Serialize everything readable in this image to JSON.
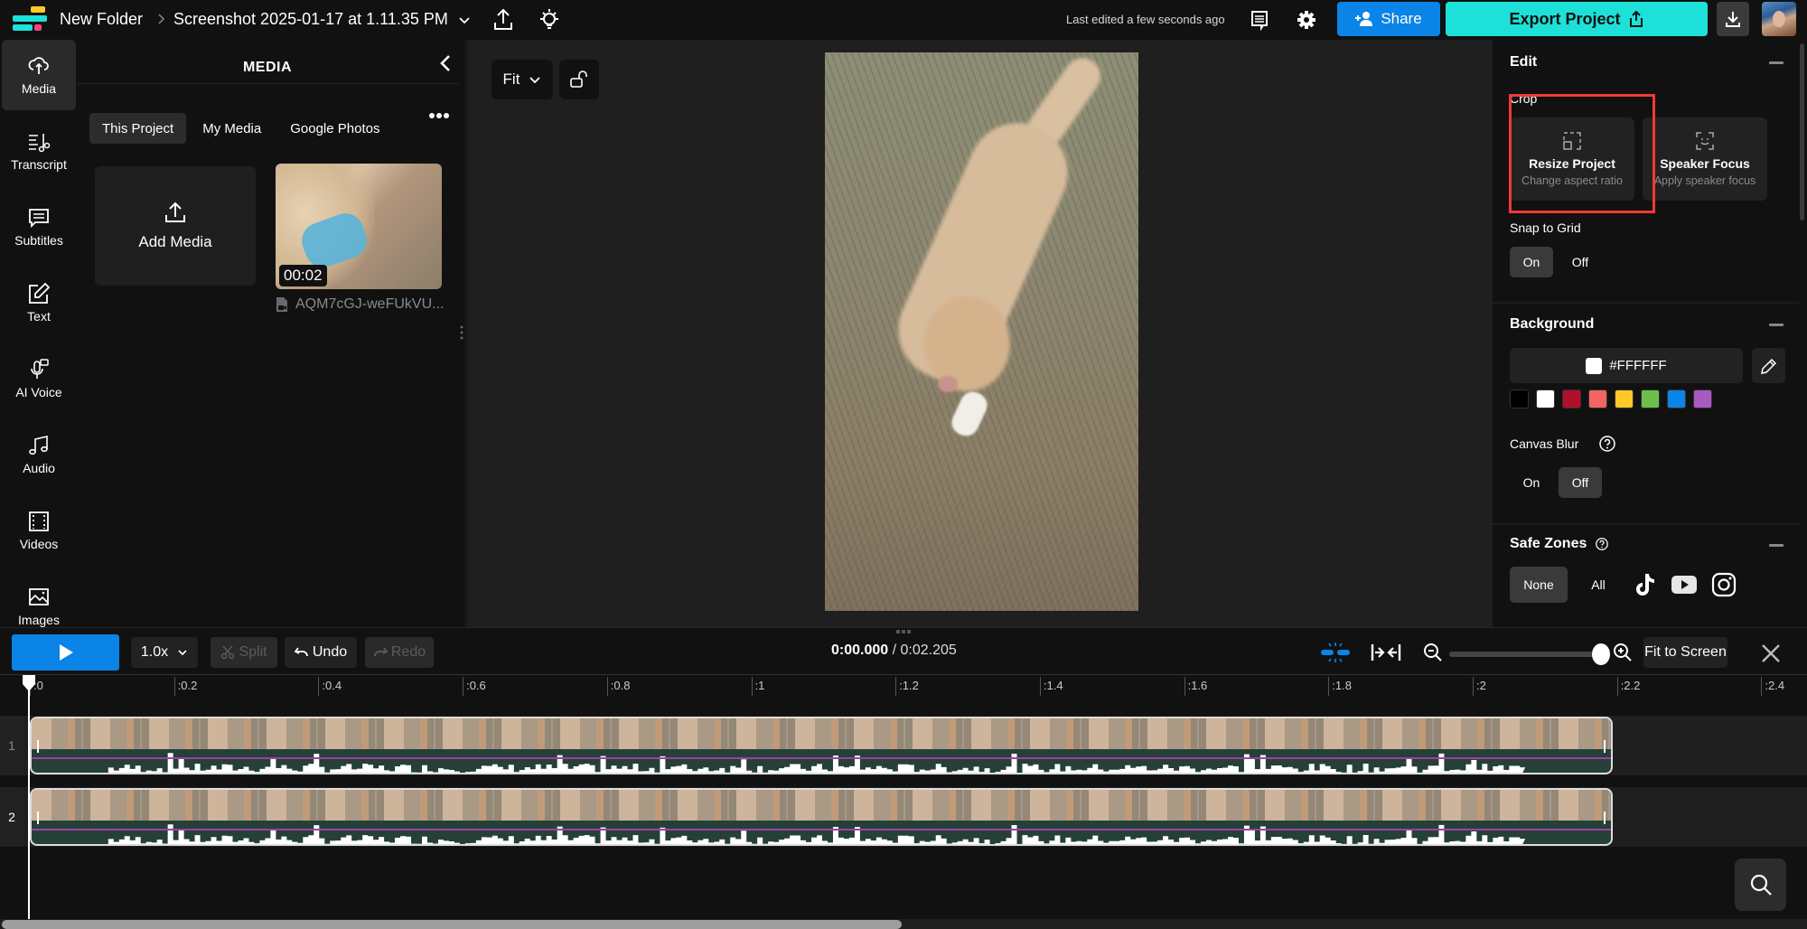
{
  "header": {
    "folder": "New Folder",
    "project_title": "Screenshot 2025-01-17 at 1.11.35 PM",
    "last_edited": "Last edited a few seconds ago",
    "share_label": "Share",
    "export_label": "Export Project"
  },
  "colors": {
    "accent_blue": "#0A84E6",
    "accent_teal": "#1DE1D8",
    "highlight_red": "#F03A34"
  },
  "sidebar": {
    "items": [
      {
        "label": "Media",
        "icon": "cloud-upload-icon",
        "active": true
      },
      {
        "label": "Transcript",
        "icon": "transcript-icon"
      },
      {
        "label": "Subtitles",
        "icon": "subtitles-icon"
      },
      {
        "label": "Text",
        "icon": "text-edit-icon"
      },
      {
        "label": "AI Voice",
        "icon": "ai-voice-icon"
      },
      {
        "label": "Audio",
        "icon": "music-note-icon"
      },
      {
        "label": "Videos",
        "icon": "film-icon"
      },
      {
        "label": "Images",
        "icon": "image-icon"
      }
    ]
  },
  "media_panel": {
    "title": "MEDIA",
    "tabs": [
      {
        "label": "This Project",
        "active": true
      },
      {
        "label": "My Media"
      },
      {
        "label": "Google Photos"
      }
    ],
    "add_media_label": "Add Media",
    "items": [
      {
        "duration": "00:02",
        "filename": "AQM7cGJ-weFUkVU..."
      }
    ]
  },
  "preview": {
    "fit_label": "Fit"
  },
  "edit_panel": {
    "edit": {
      "title": "Edit",
      "crop_label": "Crop",
      "cards": [
        {
          "title": "Resize Project",
          "subtitle": "Change aspect ratio"
        },
        {
          "title": "Speaker Focus",
          "subtitle": "Apply speaker focus"
        }
      ],
      "snap_label": "Snap to Grid",
      "snap_options": [
        "On",
        "Off"
      ],
      "snap_selected": "On"
    },
    "background": {
      "title": "Background",
      "color_value": "#FFFFFF",
      "swatches": [
        "#000000",
        "#FFFFFF",
        "#B0102A",
        "#F56464",
        "#FFC926",
        "#6CC04A",
        "#0A84E6",
        "#A85AC0"
      ],
      "blur_label": "Canvas Blur",
      "blur_options": [
        "On",
        "Off"
      ],
      "blur_selected": "Off"
    },
    "safe_zones": {
      "title": "Safe Zones",
      "options": [
        "None",
        "All"
      ],
      "selected": "None",
      "platforms": [
        "tiktok-icon",
        "youtube-icon",
        "instagram-icon"
      ]
    }
  },
  "timeline": {
    "speed": "1.0x",
    "split_label": "Split",
    "undo_label": "Undo",
    "redo_label": "Redo",
    "current_time": "0:00.000",
    "total_time": "/ 0:02.205",
    "zoom_level": 1.0,
    "fit_to_screen_label": "Fit to Screen",
    "ruler_ticks": [
      ":0",
      ":0.2",
      ":0.4",
      ":0.6",
      ":0.8",
      ":1",
      ":1.2",
      ":1.4",
      ":1.6",
      ":1.8",
      ":2",
      ":2.2",
      ":2.4"
    ],
    "tracks": [
      {
        "number": "1"
      },
      {
        "number": "2"
      }
    ],
    "scroll_fraction": 0.5
  }
}
